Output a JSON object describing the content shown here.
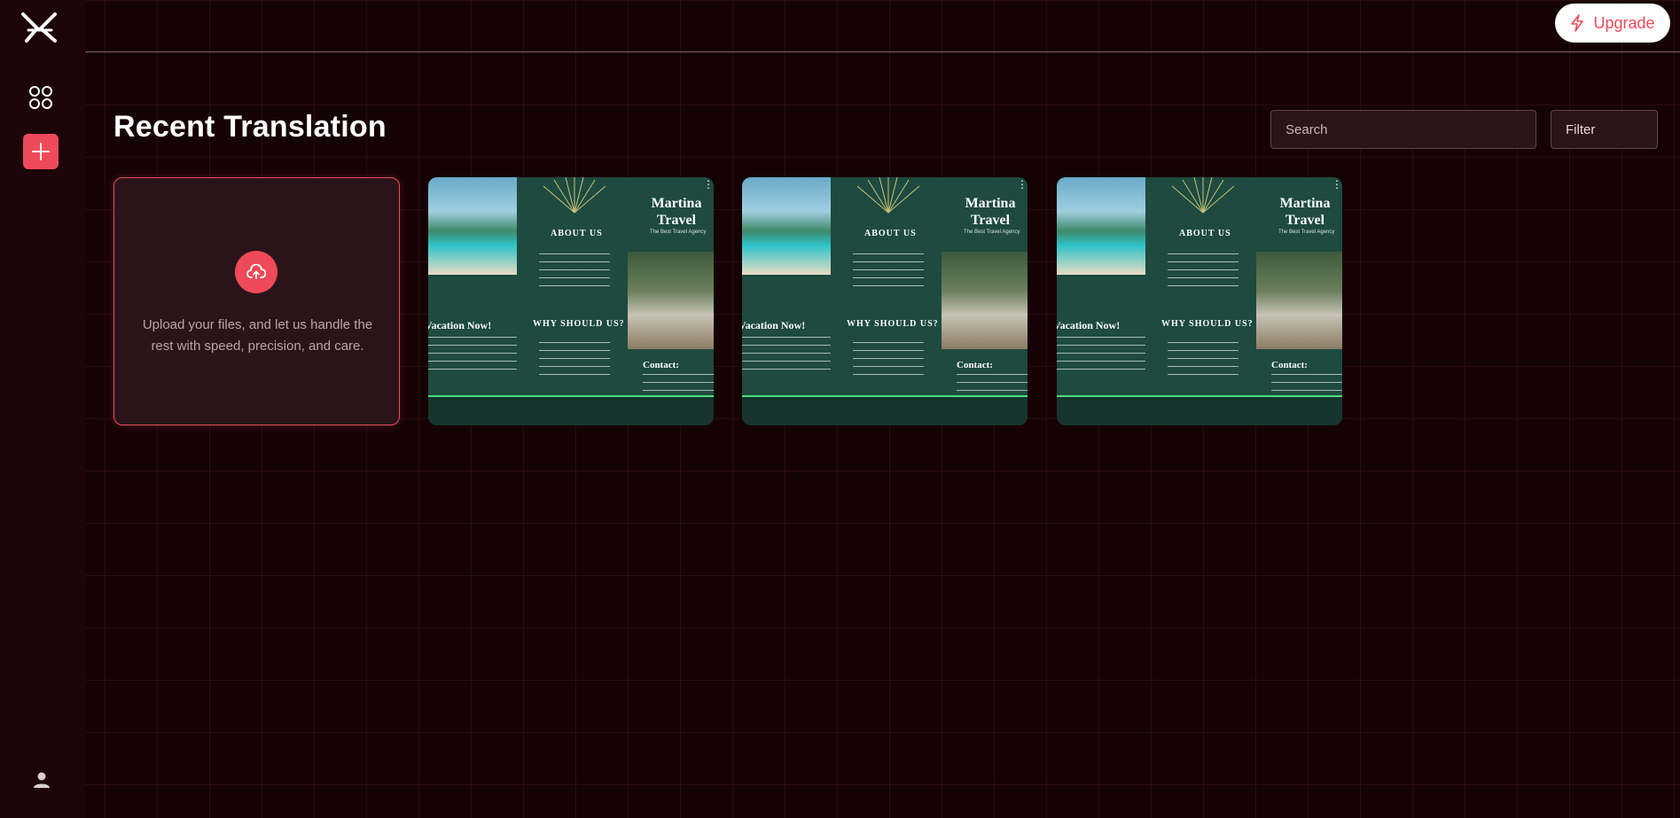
{
  "header": {
    "upgrade_label": "Upgrade"
  },
  "sidebar": {
    "items": [
      {
        "name": "logo",
        "icon": "x-logo-icon"
      },
      {
        "name": "dashboard",
        "icon": "grid-icon"
      },
      {
        "name": "new",
        "icon": "plus-icon"
      },
      {
        "name": "profile",
        "icon": "user-icon"
      }
    ]
  },
  "main": {
    "title": "Recent Translation",
    "search_placeholder": "Search",
    "filter_label": "Filter",
    "upload": {
      "text": "Upload your files, and let us handle the rest with speed, precision, and care.",
      "icon": "cloud-upload-icon"
    },
    "documents": [
      {
        "title_line1": "Martina",
        "title_line2": "Travel",
        "subtitle": "The Best Travel Agency",
        "about": "ABOUT US",
        "why": "WHY SHOULD US?",
        "vacation": "Vacation Now!",
        "contact": "Contact:"
      },
      {
        "title_line1": "Martina",
        "title_line2": "Travel",
        "subtitle": "The Best Travel Agency",
        "about": "ABOUT US",
        "why": "WHY SHOULD US?",
        "vacation": "Vacation Now!",
        "contact": "Contact:"
      },
      {
        "title_line1": "Martina",
        "title_line2": "Travel",
        "subtitle": "The Best Travel Agency",
        "about": "ABOUT US",
        "why": "WHY SHOULD US?",
        "vacation": "Vacation Now!",
        "contact": "Contact:"
      }
    ]
  },
  "colors": {
    "background": "#150205",
    "sidebar": "#1d0408",
    "accent": "#ef4a5a",
    "card": "#2b1419",
    "brochure_green": "#1e4a3f"
  }
}
